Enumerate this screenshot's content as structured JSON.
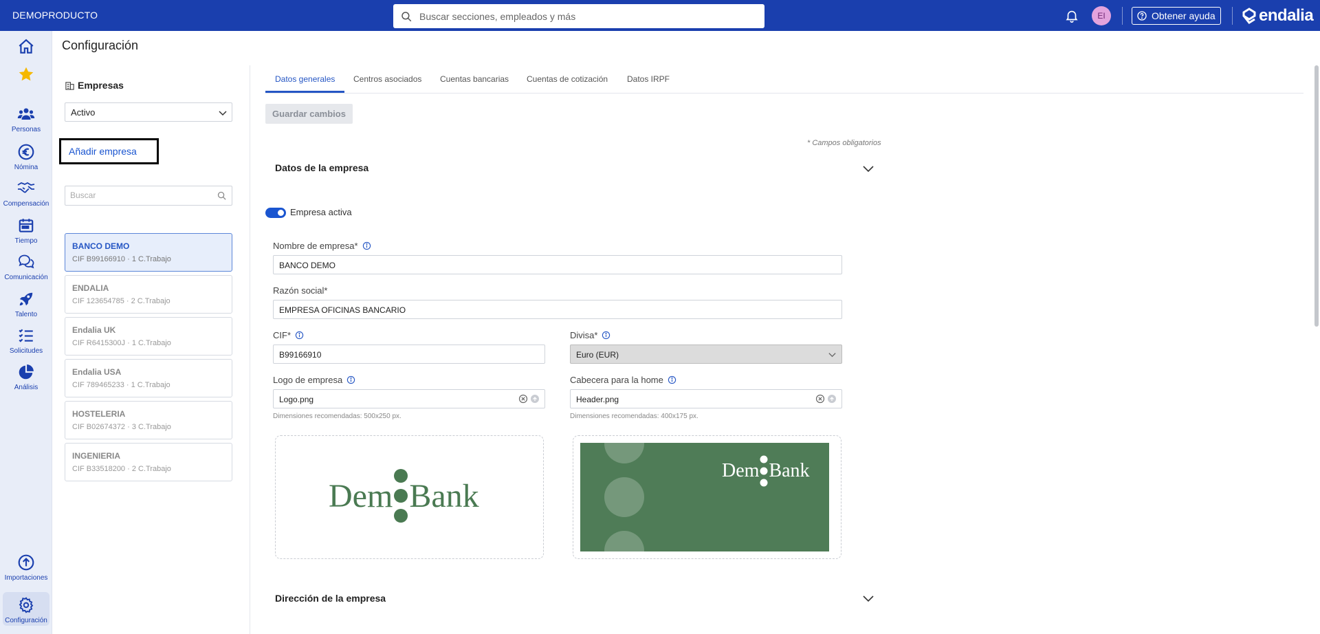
{
  "topbar": {
    "company": "DEMOPRODUCTO",
    "search_placeholder": "Buscar secciones, empleados y más",
    "avatar_initials": "EI",
    "help_label": "Obtener ayuda",
    "logo_text": "endalia"
  },
  "rail": {
    "personas": "Personas",
    "nomina": "Nómina",
    "compensacion": "Compensación",
    "tiempo": "Tiempo",
    "comunicacion": "Comunicación",
    "talento": "Talento",
    "solicitudes": "Solicitudes",
    "analisis": "Análisis",
    "importaciones": "Importaciones",
    "configuracion": "Configuración"
  },
  "page": {
    "title": "Configuración"
  },
  "companies_panel": {
    "heading": "Empresas",
    "status_filter": "Activo",
    "add_label": "Añadir empresa",
    "search_placeholder": "Buscar",
    "items": [
      {
        "name": "BANCO DEMO",
        "info": "CIF B99166910 · 1 C.Trabajo"
      },
      {
        "name": "ENDALIA",
        "info": "CIF 123654785 · 2 C.Trabajo"
      },
      {
        "name": "Endalia UK",
        "info": "CIF R6415300J · 1 C.Trabajo"
      },
      {
        "name": "Endalia USA",
        "info": "CIF 789465233 · 1 C.Trabajo"
      },
      {
        "name": "HOSTELERIA",
        "info": "CIF B02674372 · 3 C.Trabajo"
      },
      {
        "name": "INGENIERIA",
        "info": "CIF B33518200 · 2 C.Trabajo"
      }
    ]
  },
  "tabs": [
    "Datos generales",
    "Centros asociados",
    "Cuentas bancarias",
    "Cuentas de cotización",
    "Datos IRPF"
  ],
  "form": {
    "save_label": "Guardar cambios",
    "required_note": "* Campos obligatorios",
    "section_company": "Datos de la empresa",
    "active_label": "Empresa activa",
    "name_label": "Nombre de empresa*",
    "name_value": "BANCO DEMO",
    "social_label": "Razón social*",
    "social_value": "EMPRESA OFICINAS  BANCARIO",
    "cif_label": "CIF*",
    "cif_value": "B99166910",
    "currency_label": "Divisa*",
    "currency_value": "Euro (EUR)",
    "logo_label": "Logo de empresa",
    "logo_value": "Logo.png",
    "logo_hint": "Dimensiones recomendadas: 500x250 px.",
    "header_label": "Cabecera para la home",
    "header_value": "Header.png",
    "header_hint": "Dimensiones recomendadas: 400x175 px.",
    "bank_logo_left": "Dem",
    "bank_logo_right": "Bank",
    "section_address": "Dirección de la empresa"
  },
  "colors": {
    "primary": "#1a3fae",
    "accent": "#2556c4",
    "header_green": "#4f7c57",
    "logo_green": "#4a7a52"
  }
}
